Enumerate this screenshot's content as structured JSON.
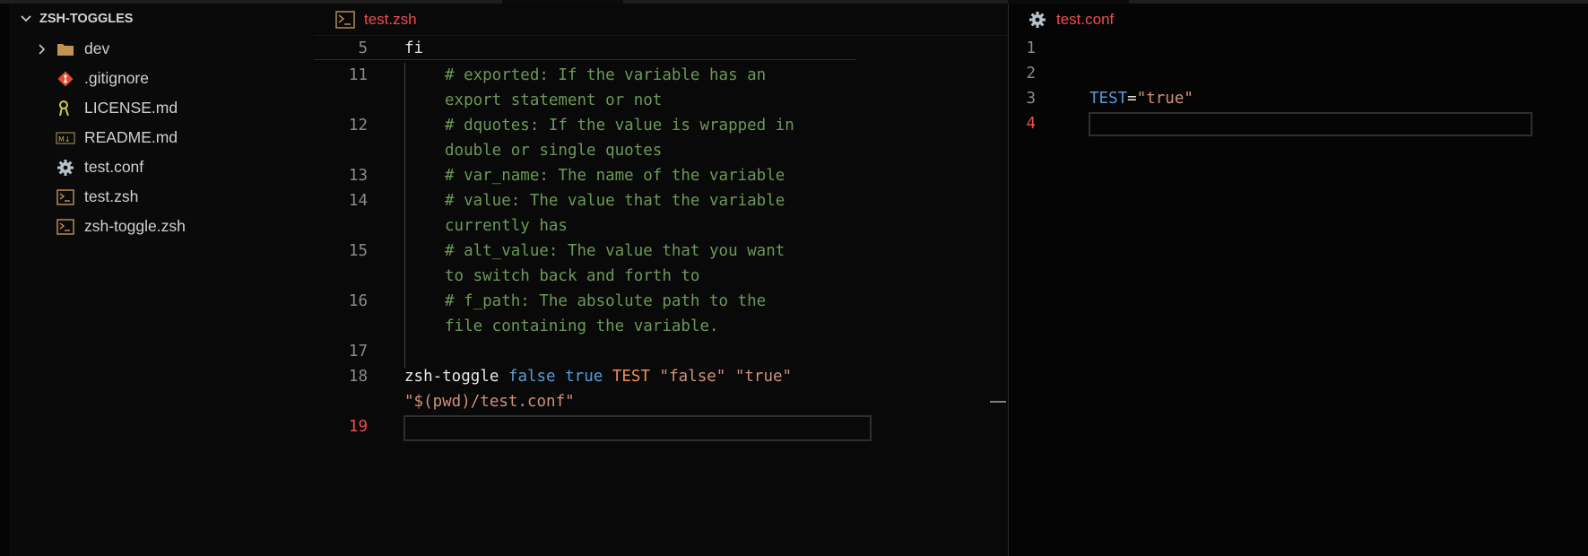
{
  "explorer": {
    "title": "ZSH-TOGGLES",
    "items": [
      {
        "label": "dev",
        "icon": "folder-icon",
        "expandable": true
      },
      {
        "label": ".gitignore",
        "icon": "git-icon"
      },
      {
        "label": "LICENSE.md",
        "icon": "license-icon"
      },
      {
        "label": "README.md",
        "icon": "markdown-icon"
      },
      {
        "label": "test.conf",
        "icon": "gear-icon"
      },
      {
        "label": "test.zsh",
        "icon": "terminal-icon"
      },
      {
        "label": "zsh-toggle.zsh",
        "icon": "terminal-icon"
      }
    ]
  },
  "editor1": {
    "tab": "test.zsh",
    "sticky": {
      "num": "5",
      "text": "fi"
    },
    "lines": {
      "n11": "11",
      "n12": "12",
      "n13": "13",
      "n14": "14",
      "n15": "15",
      "n16": "16",
      "n17": "17",
      "n18": "18",
      "n19": "19",
      "l11a": "# exported: If the variable has an",
      "l11b": "export statement or not",
      "l12a": "# dquotes: If the value is wrapped in",
      "l12b": "double or single quotes",
      "l13": "# var_name: The name of the variable",
      "l14a": "# value: The value that the variable",
      "l14b": "currently has",
      "l15a": "# alt_value: The value that you want",
      "l15b": "to switch back and forth to",
      "l16a": "# f_path: The absolute path to the",
      "l16b": "file containing the variable.",
      "l18_cmd": "zsh-toggle",
      "l18_false": "false",
      "l18_true": "true",
      "l18_test": "TEST",
      "l18_s1": "\"false\"",
      "l18_s2": "\"true\"",
      "l18_wrap": "\"$(pwd)/test.conf\""
    }
  },
  "editor2": {
    "tab": "test.conf",
    "n1": "1",
    "n2": "2",
    "n3": "3",
    "n4": "4",
    "l3_var": "TEST",
    "l3_eq": "=",
    "l3_val": "\"true\""
  },
  "colors": {
    "accent_error": "#f14c4c",
    "comment": "#6a9955",
    "keyword": "#569cd6",
    "string": "#ce9178",
    "variable": "#f28b54"
  }
}
